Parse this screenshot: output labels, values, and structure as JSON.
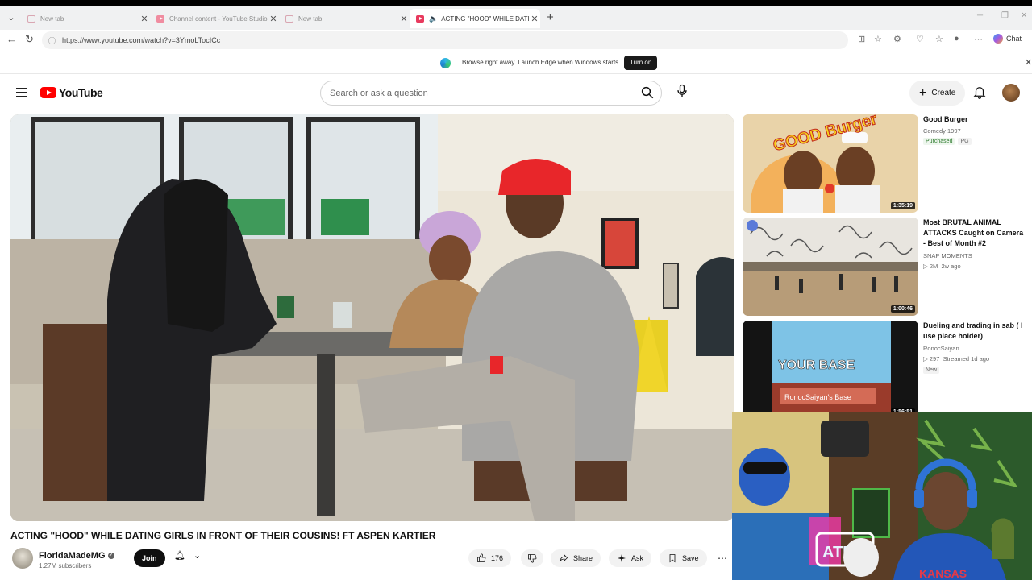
{
  "browser": {
    "tabs": [
      {
        "label": "New tab",
        "active": false
      },
      {
        "label": "Channel content - YouTube Studio",
        "active": false
      },
      {
        "label": "New tab",
        "active": false
      },
      {
        "label": "ACTING \"HOOD\" WHILE DATI",
        "active": true
      }
    ],
    "url": "https://www.youtube.com/watch?v=3YmoLTocICc",
    "chat_label": "Chat"
  },
  "edge_banner": {
    "message": "Browse right away. Launch Edge when Windows starts.",
    "button": "Turn on"
  },
  "youtube": {
    "logo_text": "YouTube",
    "search_placeholder": "Search or ask a question",
    "create_label": "Create"
  },
  "video": {
    "title": "ACTING \"HOOD\" WHILE DATING GIRLS IN FRONT OF THEIR COUSINS! FT ASPEN KARTIER",
    "channel": "FloridaMadeMG",
    "subscribers": "1.27M subscribers",
    "join_label": "Join",
    "likes": "176",
    "share_label": "Share",
    "ask_label": "Ask",
    "save_label": "Save"
  },
  "recommendations": [
    {
      "title": "Good Burger",
      "line1": "Comedy 1997",
      "badges": [
        "Purchased",
        "PG"
      ],
      "duration": "1:35:19",
      "thumb_text": "GOOD Burger"
    },
    {
      "title": "Most BRUTAL ANIMAL ATTACKS Caught on Camera - Best of Month #2",
      "channel": "SNAP MOMENTS",
      "views": "2M",
      "age": "2w ago",
      "duration": "1:00:46"
    },
    {
      "title": "Dueling and trading in sab ( I use place holder)",
      "channel": "RonocSaiyan",
      "views": "297",
      "age": "Streamed 1d ago",
      "badges": [
        "New"
      ],
      "duration": "1:56:51",
      "thumb_text": "YOUR BASE",
      "thumb_sub": "RonocSaiyan's Base"
    }
  ],
  "webcam": {
    "sign_text": "ATM",
    "shirt_text": "KANSAS"
  }
}
